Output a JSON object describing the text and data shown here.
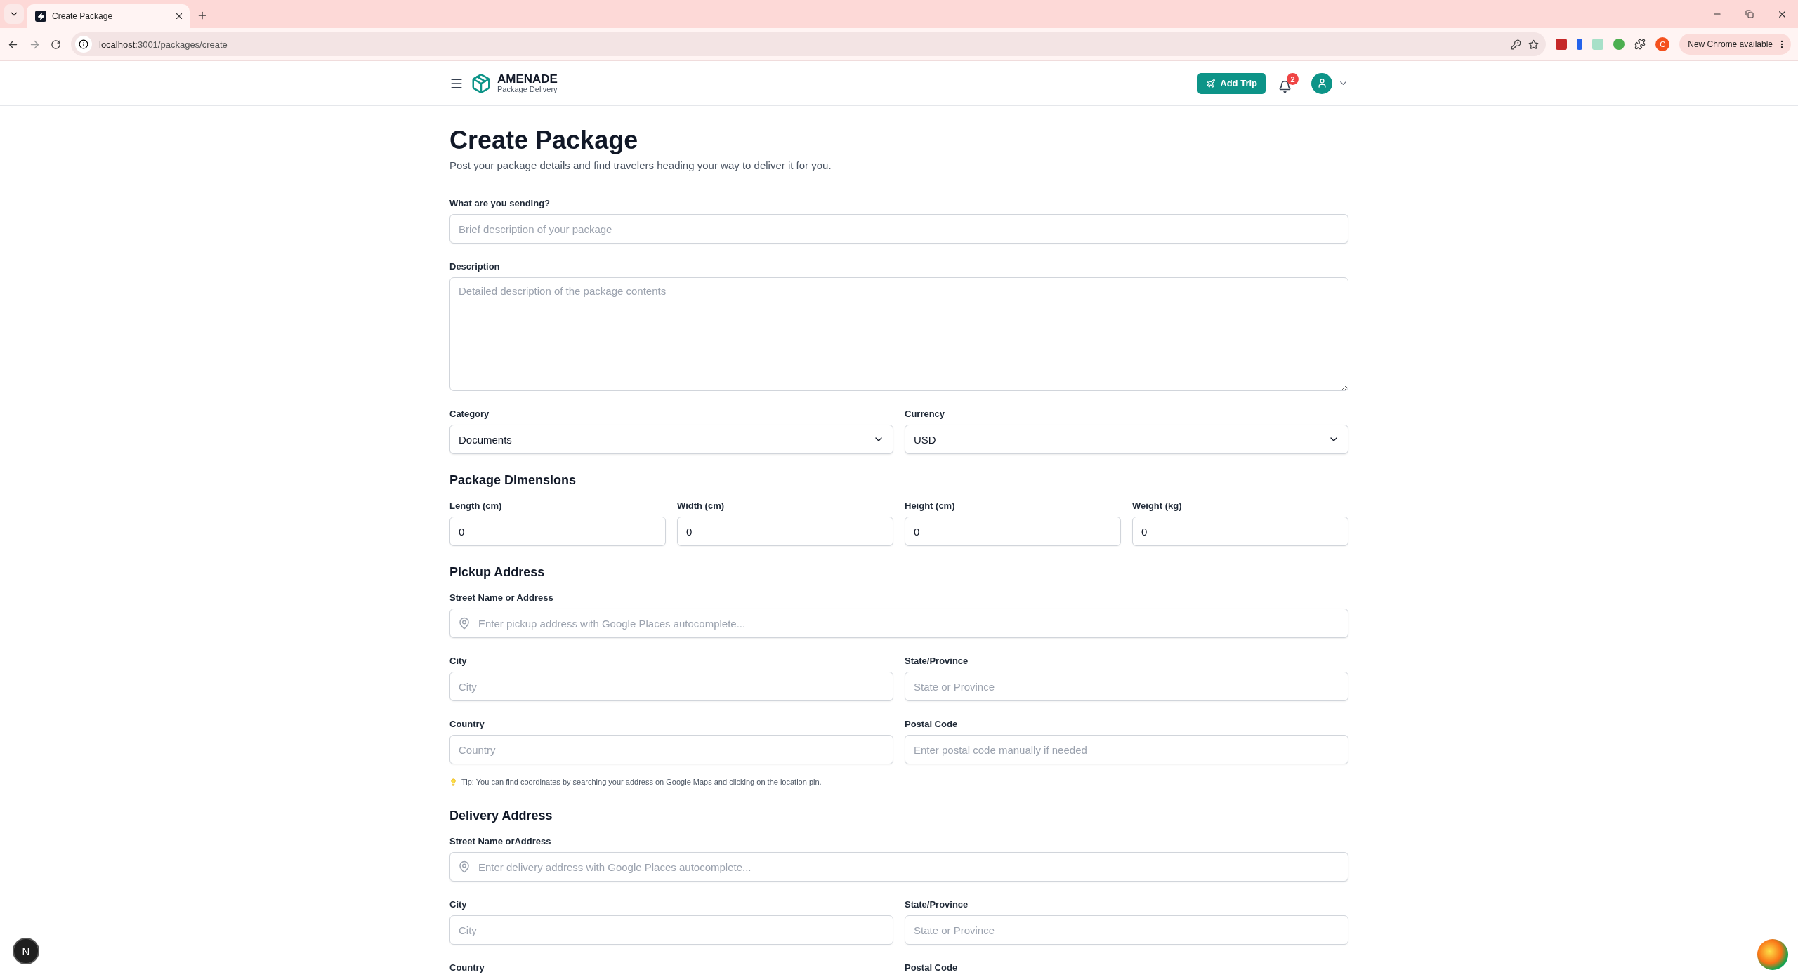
{
  "browser": {
    "tabs": [
      {
        "title": "Create Package",
        "selected": true
      }
    ],
    "url_host": "localhost",
    "url_rest": ":3001/packages/create",
    "profile_initial": "C",
    "update_label": "New Chrome available"
  },
  "header": {
    "brand": "AMENADE",
    "tagline": "Package Delivery",
    "add_trip": "Add Trip",
    "notification_count": "2"
  },
  "title": "Create Package",
  "subtitle": "Post your package details and find travelers heading your way to deliver it for you.",
  "form": [
    {
      "kind": "row",
      "fields": [
        {
          "label": "What are you sending?",
          "kind": "text",
          "placeholder": "Brief description of your package"
        }
      ]
    },
    {
      "kind": "row",
      "fields": [
        {
          "label": "Description",
          "kind": "textarea",
          "placeholder": "Detailed description of the package contents"
        }
      ]
    },
    {
      "kind": "row",
      "fields": [
        {
          "label": "Category",
          "kind": "select",
          "value": "Documents"
        },
        {
          "label": "Currency",
          "kind": "select",
          "value": "USD"
        }
      ]
    },
    {
      "kind": "heading",
      "text": "Package Dimensions"
    },
    {
      "kind": "row",
      "fields": [
        {
          "label": "Length (cm)",
          "kind": "text",
          "value": "0"
        },
        {
          "label": "Width (cm)",
          "kind": "text",
          "value": "0"
        },
        {
          "label": "Height (cm)",
          "kind": "text",
          "value": "0"
        },
        {
          "label": "Weight (kg)",
          "kind": "text",
          "value": "0"
        }
      ]
    },
    {
      "kind": "heading",
      "text": "Pickup Address"
    },
    {
      "kind": "row",
      "fields": [
        {
          "label": "Street Name or Address",
          "kind": "address",
          "placeholder": "Enter pickup address with Google Places autocomplete..."
        }
      ]
    },
    {
      "kind": "row",
      "fields": [
        {
          "label": "City",
          "kind": "text",
          "placeholder": "City"
        },
        {
          "label": "State/Province",
          "kind": "text",
          "placeholder": "State or Province"
        }
      ]
    },
    {
      "kind": "row",
      "fields": [
        {
          "label": "Country",
          "kind": "text",
          "placeholder": "Country"
        },
        {
          "label": "Postal Code",
          "kind": "text",
          "placeholder": "Enter postal code manually if needed"
        }
      ]
    },
    {
      "kind": "tip",
      "text": "Tip: You can find coordinates by searching your address on Google Maps and clicking on the location pin."
    },
    {
      "kind": "heading",
      "text": "Delivery Address"
    },
    {
      "kind": "row",
      "fields": [
        {
          "label": "Street Name orAddress",
          "kind": "address",
          "placeholder": "Enter delivery address with Google Places autocomplete..."
        }
      ]
    },
    {
      "kind": "row",
      "fields": [
        {
          "label": "City",
          "kind": "text",
          "placeholder": "City"
        },
        {
          "label": "State/Province",
          "kind": "text",
          "placeholder": "State or Province"
        }
      ]
    },
    {
      "kind": "row",
      "fields": [
        {
          "label": "Country",
          "kind": "text"
        },
        {
          "label": "Postal Code",
          "kind": "text"
        }
      ]
    }
  ],
  "dev_badge": "N"
}
